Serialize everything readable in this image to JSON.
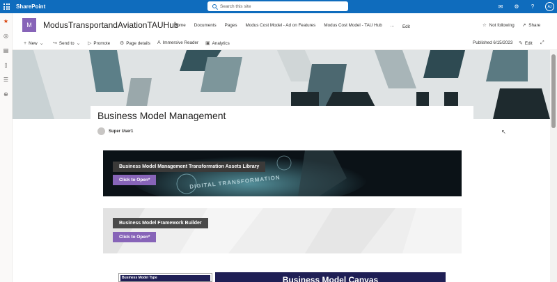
{
  "suite": {
    "brand": "SharePoint",
    "search_placeholder": "Search this site",
    "avatar_initials": "AJ"
  },
  "site": {
    "logo_letter": "M",
    "title": "ModusTransportandAviationTAUHub",
    "nav": [
      "Home",
      "Documents",
      "Pages",
      "Modus Cost Model - Ad on Features",
      "Modus Cost Model - TAU Hub",
      "..."
    ],
    "edit_label": "Edit",
    "follow_label": "Not following",
    "share_label": "Share"
  },
  "commands": {
    "new": "New",
    "send_to": "Send to",
    "promote": "Promote",
    "page_details": "Page details",
    "immersive_reader": "Immersive Reader",
    "analytics": "Analytics",
    "published": "Published 6/15/2023",
    "edit": "Edit"
  },
  "page": {
    "title": "Business Model Management",
    "author": "Super User1"
  },
  "banners": [
    {
      "label": "Business Model Management Transformation Assets Library",
      "button": "Click to Open*",
      "overlay_text": "DIGITAL TRANSFORMATION"
    },
    {
      "label": "Business Model Framework Builder",
      "button": "Click to Open*"
    }
  ],
  "canvas": {
    "left_title": "Business Model Type",
    "right_title": "Business Model Canvas"
  },
  "colors": {
    "suite_blue": "#0f6cbd",
    "accent_purple": "#8764b8",
    "canvas_navy": "#1f1f55"
  }
}
